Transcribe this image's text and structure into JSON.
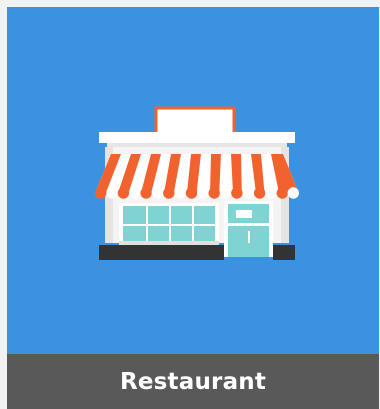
{
  "tile": {
    "label": "Restaurant",
    "icon": "storefront-icon"
  },
  "colors": {
    "background": "#3b92e0",
    "caption_bar": "#595959",
    "caption_text": "#ffffff",
    "awning_orange": "#f2622e",
    "awning_white": "#ffffff",
    "window_teal": "#7fd3d3",
    "base_dark": "#333333"
  }
}
